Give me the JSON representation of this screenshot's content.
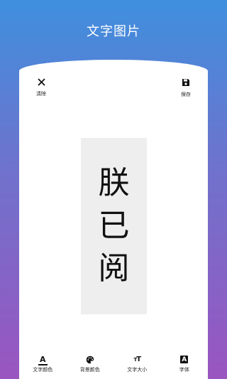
{
  "header": {
    "title": "文字图片"
  },
  "toolbar": {
    "clear_label": "清除",
    "save_label": "保存",
    "clear_icon": "close-icon",
    "save_icon": "floppy-disk-icon"
  },
  "canvas": {
    "background": "#eeeeee",
    "chars": [
      "朕",
      "已",
      "阅"
    ]
  },
  "bottom_bar": [
    {
      "label": "文字颜色",
      "icon": "text-color-icon"
    },
    {
      "label": "背景颜色",
      "icon": "palette-icon"
    },
    {
      "label": "文字大小",
      "icon": "text-size-icon"
    },
    {
      "label": "字体",
      "icon": "font-icon"
    }
  ],
  "colors": {
    "gradient_top": "#3f8fde",
    "gradient_bottom": "#9a55c0",
    "card": "#ffffff"
  }
}
